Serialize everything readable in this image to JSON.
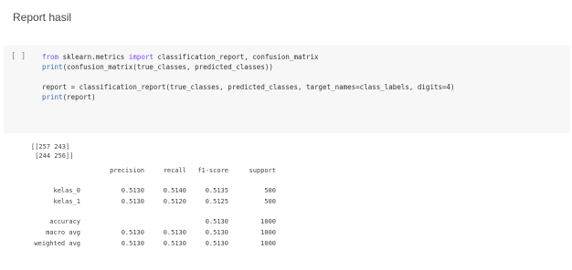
{
  "heading": "Report hasil",
  "cell": {
    "run_indicator": "[ ]",
    "line1": {
      "kw_from": "from",
      "module": " sklearn.metrics ",
      "kw_import": "import",
      "rest": " classification_report, confusion_matrix"
    },
    "line2": {
      "fn": "print",
      "rest": "(confusion_matrix(true_classes, predicted_classes))"
    },
    "line4": "report = classification_report(true_classes, predicted_classes, target_names=class_labels, digits=4)",
    "line5": {
      "fn": "print",
      "rest": "(report)"
    }
  },
  "output": {
    "matrix_line1": "[[257 243]",
    "matrix_line2": " [244 256]]",
    "report": {
      "headers": [
        "precision",
        "recall",
        "f1-score",
        "support"
      ],
      "rows": [
        {
          "label": "kelas_0",
          "precision": "0.5130",
          "recall": "0.5140",
          "f1": "0.5135",
          "support": "500"
        },
        {
          "label": "kelas_1",
          "precision": "0.5130",
          "recall": "0.5120",
          "f1": "0.5125",
          "support": "500"
        }
      ],
      "summary": [
        {
          "label": "accuracy",
          "precision": "",
          "recall": "",
          "f1": "0.5130",
          "support": "1000"
        },
        {
          "label": "macro avg",
          "precision": "0.5130",
          "recall": "0.5130",
          "f1": "0.5130",
          "support": "1000"
        },
        {
          "label": "weighted avg",
          "precision": "0.5130",
          "recall": "0.5130",
          "f1": "0.5130",
          "support": "1000"
        }
      ]
    }
  }
}
